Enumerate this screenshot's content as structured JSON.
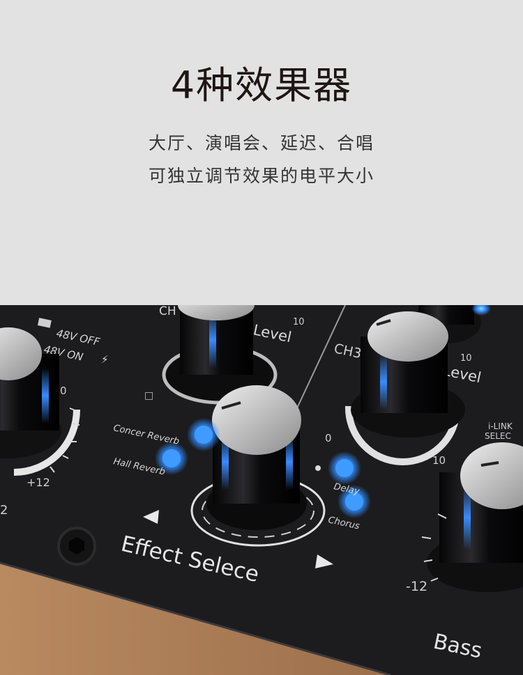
{
  "header": {
    "title": "4种效果器",
    "line1": "大厅、演唱会、延迟、合唱",
    "line2": "可独立调节效果的电平大小"
  },
  "panel": {
    "phantom_off": "48V OFF",
    "phantom_on": "48V ON",
    "ch_label_left": "CH",
    "ch_label_right": "CH3",
    "level_top": "Level",
    "level_right": "Level",
    "scale_10_top": "10",
    "scale_10_right": "10",
    "scale_10_ring": "10",
    "scale_0_left": "0",
    "scale_0_right": "0",
    "scale_plus12": "+12",
    "scale_minus12": "-12",
    "concert_reverb": "Concer Reverb",
    "hall_reverb": "Hall Reverb",
    "delay": "Delay",
    "chorus": "Chorus",
    "effect_select": "Effect Selece",
    "ilink_line1": "i-LINK",
    "ilink_line2": "SELEC",
    "bass": "Bass",
    "left_edge_2": "2",
    "small_box": "□"
  },
  "colors": {
    "panel": "#1c1c1e",
    "led": "#2f8dff",
    "knob_cap": "#c9c9c9",
    "wood": "#a87a55"
  }
}
